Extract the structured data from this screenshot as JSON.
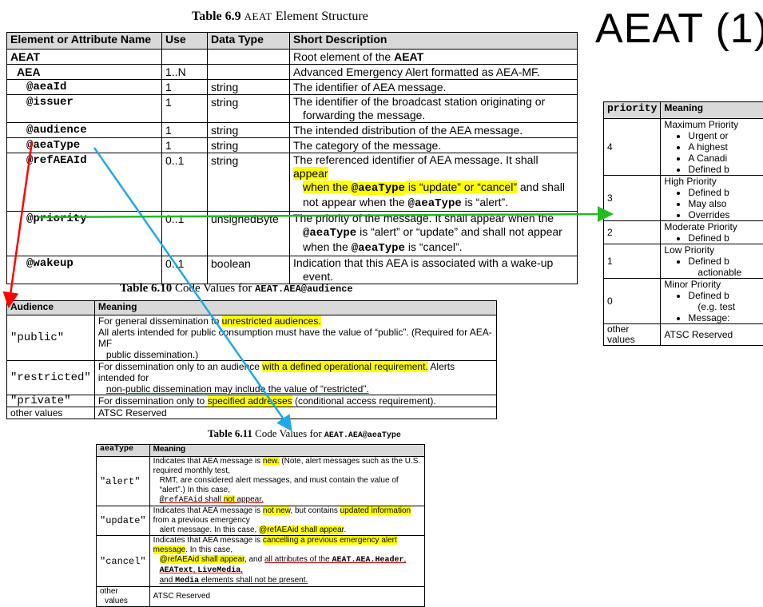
{
  "slide_title": "AEAT (1)",
  "t69": {
    "caption_prefix": "Table 6.9",
    "caption_name": "AEAT",
    "caption_rest": "Element Structure",
    "headers": [
      "Element or Attribute Name",
      "Use",
      "Data Type",
      "Short Description"
    ],
    "rows": [
      {
        "name": "AEAT",
        "use": "",
        "type": "",
        "desc_pre": "Root element of the ",
        "desc_bold": "AEAT"
      },
      {
        "name": "AEA",
        "use": "1..N",
        "type": "",
        "desc": "Advanced Emergency Alert formatted as AEA-MF."
      },
      {
        "name": "@aeaId",
        "use": "1",
        "type": "string",
        "desc": "The identifier of AEA message."
      },
      {
        "name": "@issuer",
        "use": "1",
        "type": "string",
        "desc": "The identifier of the broadcast station originating or",
        "desc2": "forwarding the message."
      },
      {
        "name": "@audience",
        "use": "1",
        "type": "string",
        "desc": "The intended distribution of the AEA message."
      },
      {
        "name": "@aeaType",
        "use": "1",
        "type": "string",
        "desc": "The category of the message."
      },
      {
        "name": "@refAEAId",
        "use": "0..1",
        "type": "string",
        "d1a": "The referenced identifier of AEA message. It shall ",
        "d1b": "appear",
        "d2a": "when the ",
        "d2b": "@aeaType",
        "d2c": " is “update” or “cancel”",
        "d2d": " and shall",
        "d3a": "not appear when the ",
        "d3b": "@aeaType",
        "d3c": " is “alert”."
      },
      {
        "name": "@priority",
        "use": "0..1",
        "type": "unsignedByte",
        "d1": "The priority of the message. It shall appear when the",
        "d2a": "@aeaType",
        "d2b": " is “alert” or “update” and shall not appear",
        "d3a": "when the ",
        "d3b": "@aeaType",
        "d3c": " is “cancel”."
      },
      {
        "name": "@wakeup",
        "use": "0..1",
        "type": "boolean",
        "desc": "Indication that this AEA is associated with a wake-up",
        "desc2": "event."
      }
    ]
  },
  "t610": {
    "caption_prefix": "Table 6.10",
    "caption_mid": "Code Values for ",
    "caption_name": "AEAT.AEA@audience",
    "headers": [
      "Audience",
      "Meaning"
    ],
    "public": {
      "code": "\"public\"",
      "l1a": "For general dissemination to ",
      "l1b": "unrestricted audiences.",
      "l2": "All alerts intended for public consumption must have the value of “public”. (Required for AEA-MF",
      "l3": "public dissemination.)"
    },
    "restricted": {
      "code": "\"restricted\"",
      "l1a": "For dissemination only to an audience ",
      "l1b": "with a defined operational requirement.",
      "l1c": " Alerts intended for",
      "l2": "non-public dissemination may include the value of “restricted”."
    },
    "private": {
      "code": "\"private\"",
      "la": "For dissemination only to ",
      "lb": "specified addresses",
      "lc": " (conditional access requirement)."
    },
    "other": {
      "code": "other values",
      "meaning": "ATSC Reserved"
    }
  },
  "t611": {
    "caption_prefix": "Table 6.11",
    "caption_mid": "Code Values for ",
    "caption_name": "AEAT.AEA@aeaType",
    "headers": [
      "aeaType",
      "Meaning"
    ],
    "alert": {
      "code": "\"alert\"",
      "l1a": "Indicates that AEA message is ",
      "l1b": "new.",
      "l1c": " (Note, alert messages such as the U.S. required monthly test,",
      "l2": "RMT, are considered alert messages, and must contain the value of “alert”.) In this case,",
      "l3a": "@refAEAid",
      "l3b": " shall ",
      "l3c": "not",
      "l3d": " appear."
    },
    "update": {
      "code": "\"update\"",
      "l1a": "Indicates that AEA message is ",
      "l1b": "not new",
      "l1c": ", but contains ",
      "l1d": "updated information",
      "l1e": " from a previous emergency",
      "l2a": "alert message. In this case, ",
      "l2b": "@refAEAid shall appear",
      "l2c": "."
    },
    "cancel": {
      "code": "\"cancel\"",
      "l1a": "Indicates that AEA message is ",
      "l1b": "cancelling a previous emergency alert message",
      "l1c": ". In this case,",
      "l2a": "@refAEAid shall appear",
      "l2b": ", and ",
      "l2c": "all attributes of the ",
      "l2d": "AEAT.AEA.Header",
      "l2e": ", ",
      "l2f": "AEAText",
      "l2g": ", ",
      "l2h": "LiveMedia",
      "l2i": ",",
      "l3a": "and ",
      "l3b": "Media",
      "l3c": " elements shall not be present."
    },
    "other": {
      "code1": "other",
      "code2": "values",
      "meaning": "ATSC Reserved"
    }
  },
  "tp": {
    "headers": [
      "priority",
      "Meaning"
    ],
    "rows": [
      {
        "num": "4",
        "title": "Maximum Priority",
        "items": [
          "Urgent or",
          "A highest",
          "A Canadi",
          "Defined b"
        ]
      },
      {
        "num": "3",
        "title": "High Priority",
        "items": [
          "Defined b",
          "May also",
          "Overrides"
        ]
      },
      {
        "num": "2",
        "title": "Moderate Priority",
        "items": [
          "Defined b"
        ]
      },
      {
        "num": "1",
        "title": "Low Priority",
        "items": [
          "Defined b"
        ],
        "extra": "actionable"
      },
      {
        "num": "0",
        "title": "Minor Priority",
        "items": [
          "Defined b"
        ],
        "extra": "(e.g. test",
        "items2": [
          "Message:"
        ]
      },
      {
        "num": "other values",
        "title": "ATSC Reserved",
        "items": []
      }
    ]
  },
  "colors": {
    "highlight": "#ffff00",
    "red_arrow": "#ff0000",
    "blue_arrow": "#22a7e8",
    "green_arrow": "#22bb22",
    "header_gray": "#d9d9d9"
  }
}
